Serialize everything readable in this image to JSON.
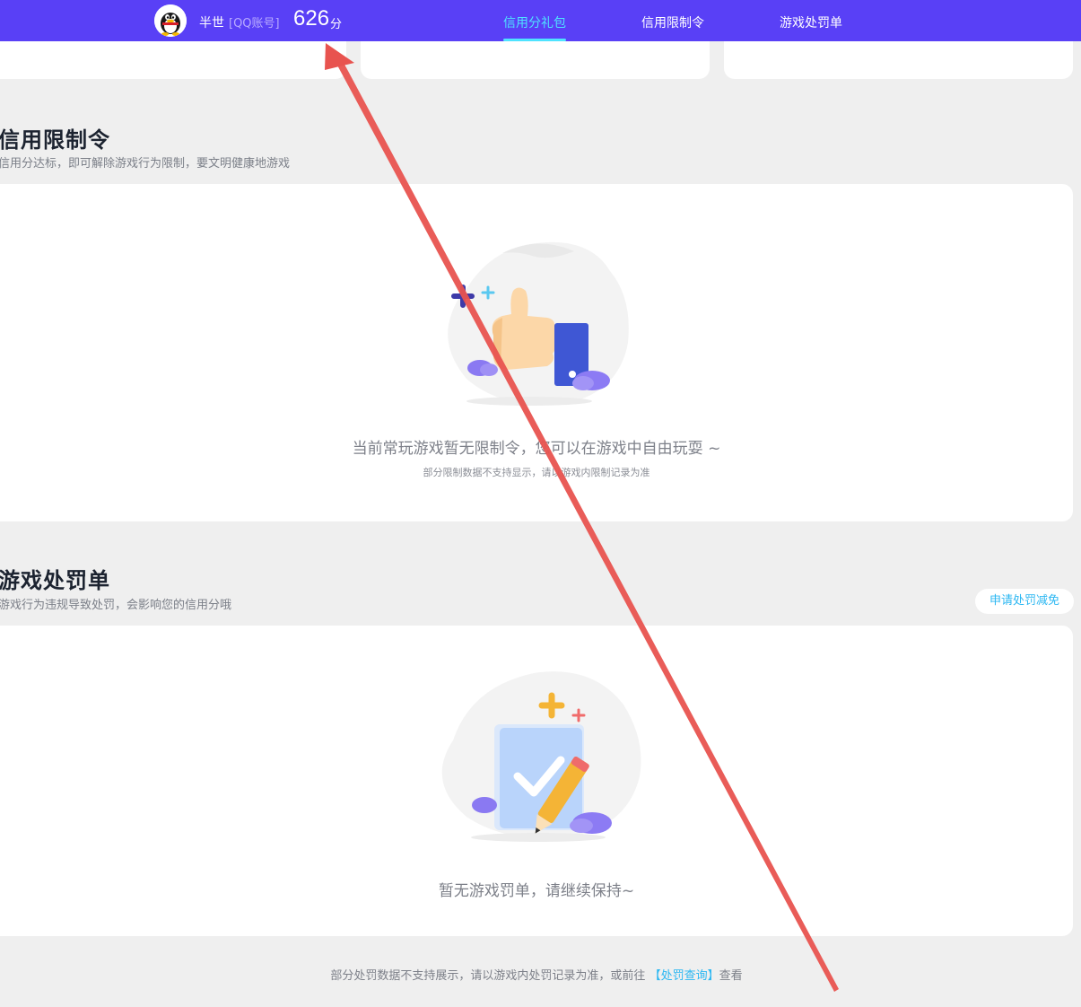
{
  "header": {
    "user_name": "半世",
    "account_type": "[QQ账号]",
    "score": "626",
    "score_unit": "分",
    "tabs": [
      {
        "label": "信用分礼包",
        "active": true
      },
      {
        "label": "信用限制令",
        "active": false
      },
      {
        "label": "游戏处罚单",
        "active": false
      }
    ]
  },
  "restriction": {
    "title": "信用限制令",
    "subtitle": "信用分达标，即可解除游戏行为限制，要文明健康地游戏",
    "empty_text": "当前常玩游戏暂无限制令，您可以在游戏中自由玩耍 ~",
    "note": "部分限制数据不支持显示，请以游戏内限制记录为准"
  },
  "penalty": {
    "title": "游戏处罚单",
    "subtitle": "游戏行为违规导致处罚，会影响您的信用分哦",
    "appeal_button": "申请处罚减免",
    "empty_text": "暂无游戏罚单，请继续保持~"
  },
  "footer": {
    "text_before": "部分处罚数据不支持展示，请以游戏内处罚记录为准，或前往",
    "link": "【处罚查询】",
    "text_after": "查看"
  },
  "colors": {
    "nav_bg": "#5940f6",
    "active_tab": "#4fe3ff",
    "link": "#2bb7f2",
    "annotation_arrow": "#e8534f"
  },
  "icons": [
    "qq-penguin-avatar-icon",
    "thumbs-up-illustration-icon",
    "checklist-pencil-illustration-icon"
  ]
}
